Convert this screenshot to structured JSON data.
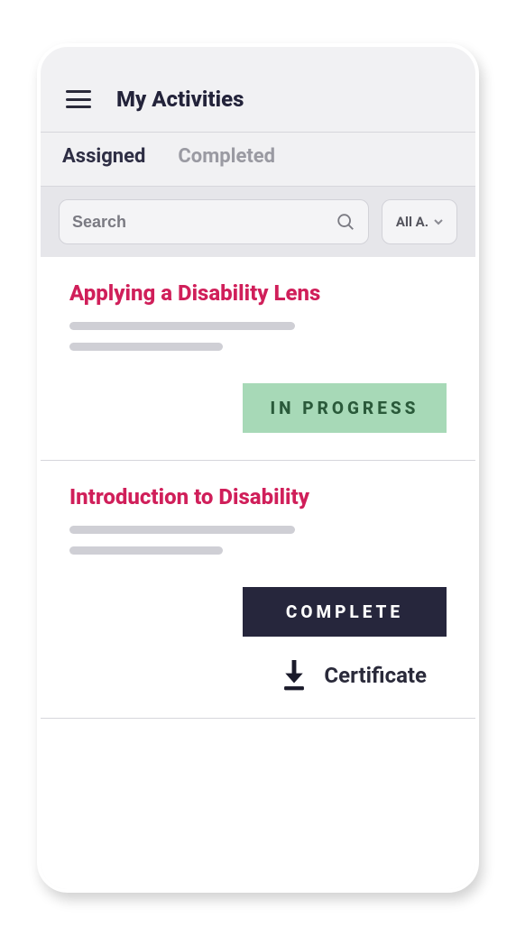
{
  "header": {
    "title": "My Activities"
  },
  "tabs": [
    {
      "label": "Assigned",
      "active": true
    },
    {
      "label": "Completed",
      "active": false
    }
  ],
  "search": {
    "placeholder": "Search",
    "value": ""
  },
  "filter": {
    "selected": "All A."
  },
  "activities": [
    {
      "title": "Applying a Disability Lens",
      "status": "IN PROGRESS",
      "status_style": "progress",
      "has_certificate": false
    },
    {
      "title": "Introduction to Disability",
      "status": "COMPLETE",
      "status_style": "complete",
      "has_certificate": true,
      "certificate_label": "Certificate"
    }
  ]
}
